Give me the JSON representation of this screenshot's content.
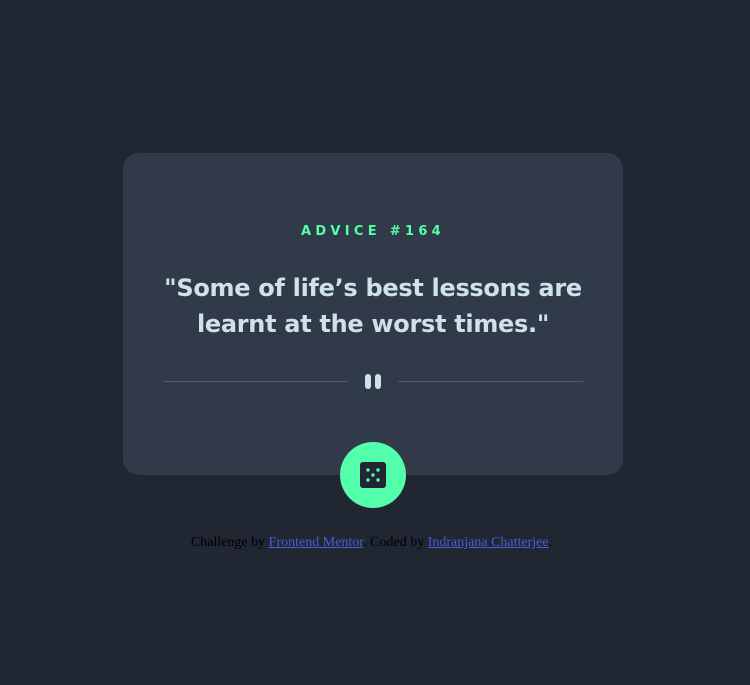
{
  "card": {
    "advice_label": "ADVICE #164",
    "quote": "\"Some of life’s best lessons are learnt at the worst times.\""
  },
  "icons": {
    "divider": "pause-icon",
    "button": "dice-icon"
  },
  "attribution": {
    "prefix": "Challenge by",
    "challenge_link": "Frontend Mentor",
    "separator": ". Coded by",
    "author_link": "Indranjana Chatterjee",
    "suffix": "."
  },
  "colors": {
    "background": "#202632",
    "card": "#313a49",
    "accent": "#53ffaa",
    "text": "#cee3e9",
    "divider": "#4e5d73",
    "link": "#4a5fd5"
  }
}
